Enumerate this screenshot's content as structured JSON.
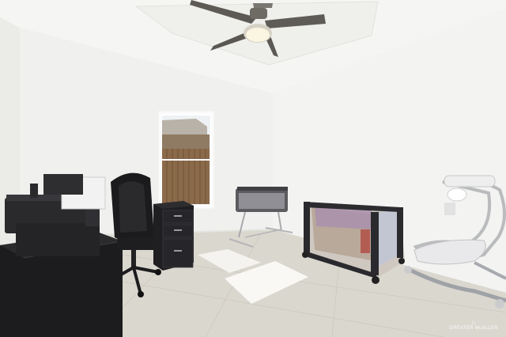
{
  "watermark": {
    "text": "GREATER McALLEN",
    "icon": "house-logo-icon"
  },
  "scene": {
    "description_free": true,
    "colors": {
      "wall": "#f1f1ef",
      "ceiling": "#f6f6f4",
      "floor": "#dcd8d0",
      "furniture_dark": "#1e1e20",
      "window_sky": "#e8eef2",
      "fence": "#8a6a4e"
    }
  }
}
